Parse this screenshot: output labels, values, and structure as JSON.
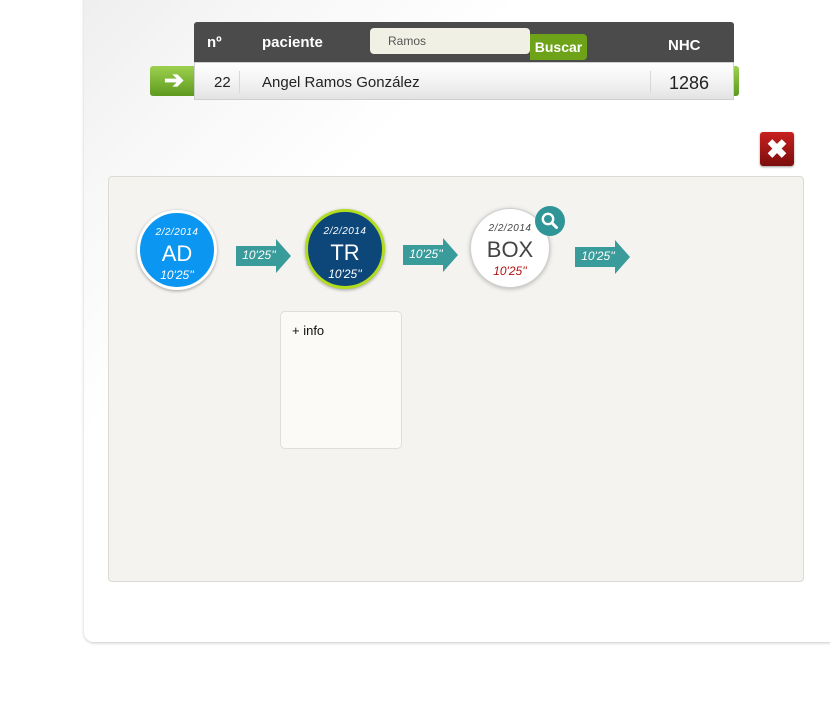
{
  "header": {
    "col_no": "nº",
    "col_patient": "paciente",
    "search_value": "Ramos",
    "search_button": "Buscar",
    "col_nhc": "NHC"
  },
  "result": {
    "number": "22",
    "name": "Angel Ramos González",
    "nhc": "1286"
  },
  "icons": {
    "go": "arrow-right",
    "close": "X",
    "zoom": "magnifier"
  },
  "timeline": {
    "steps": [
      {
        "date": "2/2/2014",
        "code": "AD",
        "time": "10'25''"
      },
      {
        "date": "2/2/2014",
        "code": "TR",
        "time": "10'25''"
      },
      {
        "date": "2/2/2014",
        "code": "BOX",
        "time": "10'25''"
      }
    ],
    "transitions": [
      "10'25''",
      "10'25''",
      "10'25''"
    ],
    "info_label": "+ info"
  },
  "colors": {
    "header_bg": "#4b4b4b",
    "accent_green": "#6ea319",
    "ad_blue": "#0b96f1",
    "tr_navy": "#0d4678",
    "tr_ring": "#b2dc1e",
    "teal": "#3a9b9b",
    "close_red": "#b3191a"
  }
}
